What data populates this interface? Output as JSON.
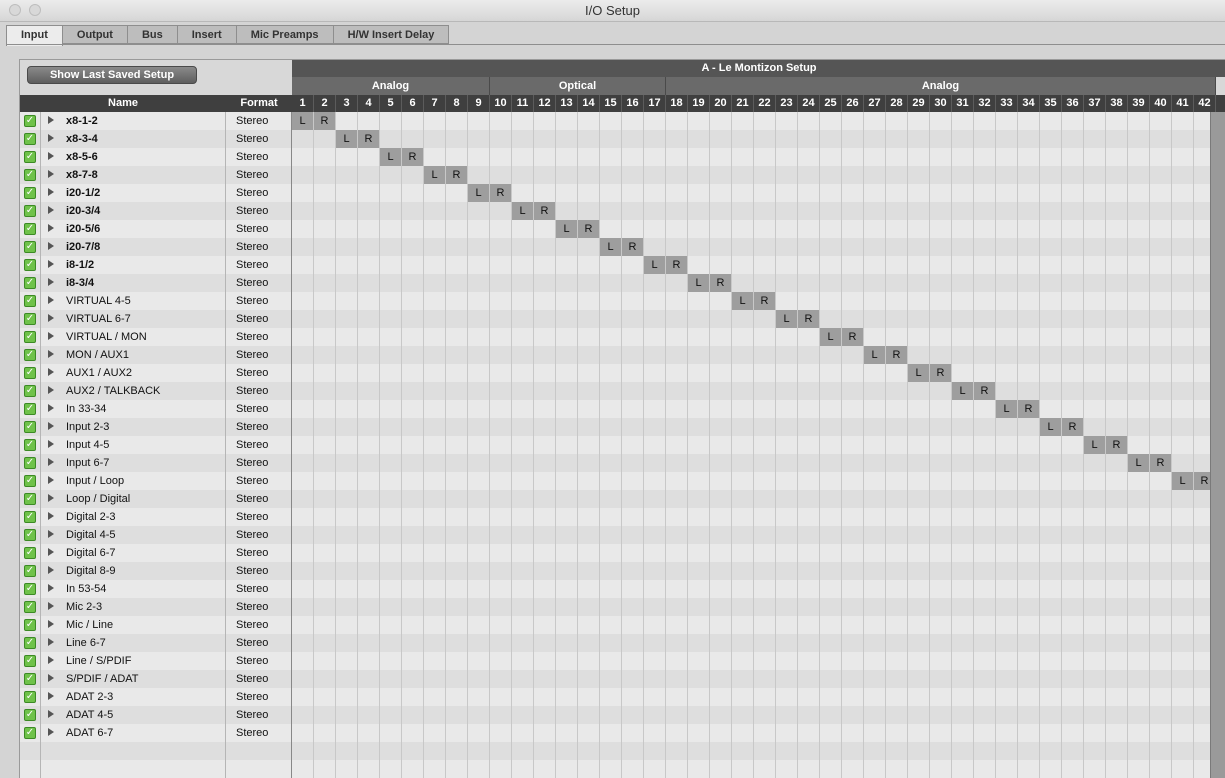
{
  "window": {
    "title": "I/O Setup"
  },
  "tabs": [
    {
      "label": "Input",
      "active": true
    },
    {
      "label": "Output",
      "active": false
    },
    {
      "label": "Bus",
      "active": false
    },
    {
      "label": "Insert",
      "active": false
    },
    {
      "label": "Mic Preamps",
      "active": false
    },
    {
      "label": "H/W Insert Delay",
      "active": false
    }
  ],
  "panel": {
    "show_last_saved_label": "Show Last Saved Setup",
    "setup_name": "A - Le Montizon Setup",
    "groups": [
      {
        "label": "Analog",
        "from": 1,
        "to": 9
      },
      {
        "label": "Optical",
        "from": 10,
        "to": 17
      },
      {
        "label": "Analog",
        "from": 18,
        "to": 42
      }
    ],
    "name_header": "Name",
    "format_header": "Format",
    "channel_count": 42
  },
  "paths": [
    {
      "name": "x8-1-2",
      "format": "Stereo",
      "bold": true,
      "channel": 1
    },
    {
      "name": "x8-3-4",
      "format": "Stereo",
      "bold": true,
      "channel": 3
    },
    {
      "name": "x8-5-6",
      "format": "Stereo",
      "bold": true,
      "channel": 5
    },
    {
      "name": "x8-7-8",
      "format": "Stereo",
      "bold": true,
      "channel": 7
    },
    {
      "name": "i20-1/2",
      "format": "Stereo",
      "bold": true,
      "channel": 9
    },
    {
      "name": "i20-3/4",
      "format": "Stereo",
      "bold": true,
      "channel": 11
    },
    {
      "name": "i20-5/6",
      "format": "Stereo",
      "bold": true,
      "channel": 13
    },
    {
      "name": "i20-7/8",
      "format": "Stereo",
      "bold": true,
      "channel": 15
    },
    {
      "name": "i8-1/2",
      "format": "Stereo",
      "bold": true,
      "channel": 17
    },
    {
      "name": "i8-3/4",
      "format": "Stereo",
      "bold": true,
      "channel": 19
    },
    {
      "name": "VIRTUAL 4-5",
      "format": "Stereo",
      "bold": false,
      "channel": 21
    },
    {
      "name": "VIRTUAL 6-7",
      "format": "Stereo",
      "bold": false,
      "channel": 23
    },
    {
      "name": "VIRTUAL / MON",
      "format": "Stereo",
      "bold": false,
      "channel": 25
    },
    {
      "name": "MON / AUX1",
      "format": "Stereo",
      "bold": false,
      "channel": 27
    },
    {
      "name": "AUX1 / AUX2",
      "format": "Stereo",
      "bold": false,
      "channel": 29
    },
    {
      "name": "AUX2 / TALKBACK",
      "format": "Stereo",
      "bold": false,
      "channel": 31
    },
    {
      "name": "In 33-34",
      "format": "Stereo",
      "bold": false,
      "channel": 33
    },
    {
      "name": "Input 2-3",
      "format": "Stereo",
      "bold": false,
      "channel": 35
    },
    {
      "name": "Input 4-5",
      "format": "Stereo",
      "bold": false,
      "channel": 37
    },
    {
      "name": "Input 6-7",
      "format": "Stereo",
      "bold": false,
      "channel": 39
    },
    {
      "name": "Input / Loop",
      "format": "Stereo",
      "bold": false,
      "channel": 41
    },
    {
      "name": "Loop / Digital",
      "format": "Stereo",
      "bold": false,
      "channel": null
    },
    {
      "name": "Digital 2-3",
      "format": "Stereo",
      "bold": false,
      "channel": null
    },
    {
      "name": "Digital 4-5",
      "format": "Stereo",
      "bold": false,
      "channel": null
    },
    {
      "name": "Digital 6-7",
      "format": "Stereo",
      "bold": false,
      "channel": null
    },
    {
      "name": "Digital 8-9",
      "format": "Stereo",
      "bold": false,
      "channel": null
    },
    {
      "name": "In 53-54",
      "format": "Stereo",
      "bold": false,
      "channel": null
    },
    {
      "name": "Mic 2-3",
      "format": "Stereo",
      "bold": false,
      "channel": null
    },
    {
      "name": "Mic / Line",
      "format": "Stereo",
      "bold": false,
      "channel": null
    },
    {
      "name": "Line 6-7",
      "format": "Stereo",
      "bold": false,
      "channel": null
    },
    {
      "name": "Line / S/PDIF",
      "format": "Stereo",
      "bold": false,
      "channel": null
    },
    {
      "name": "S/PDIF / ADAT",
      "format": "Stereo",
      "bold": false,
      "channel": null
    },
    {
      "name": "ADAT 2-3",
      "format": "Stereo",
      "bold": false,
      "channel": null
    },
    {
      "name": "ADAT 4-5",
      "format": "Stereo",
      "bold": false,
      "channel": null
    },
    {
      "name": "ADAT 6-7",
      "format": "Stereo",
      "bold": false,
      "channel": null
    }
  ],
  "assign_labels": {
    "left": "L",
    "right": "R"
  },
  "check_glyph": "✓"
}
